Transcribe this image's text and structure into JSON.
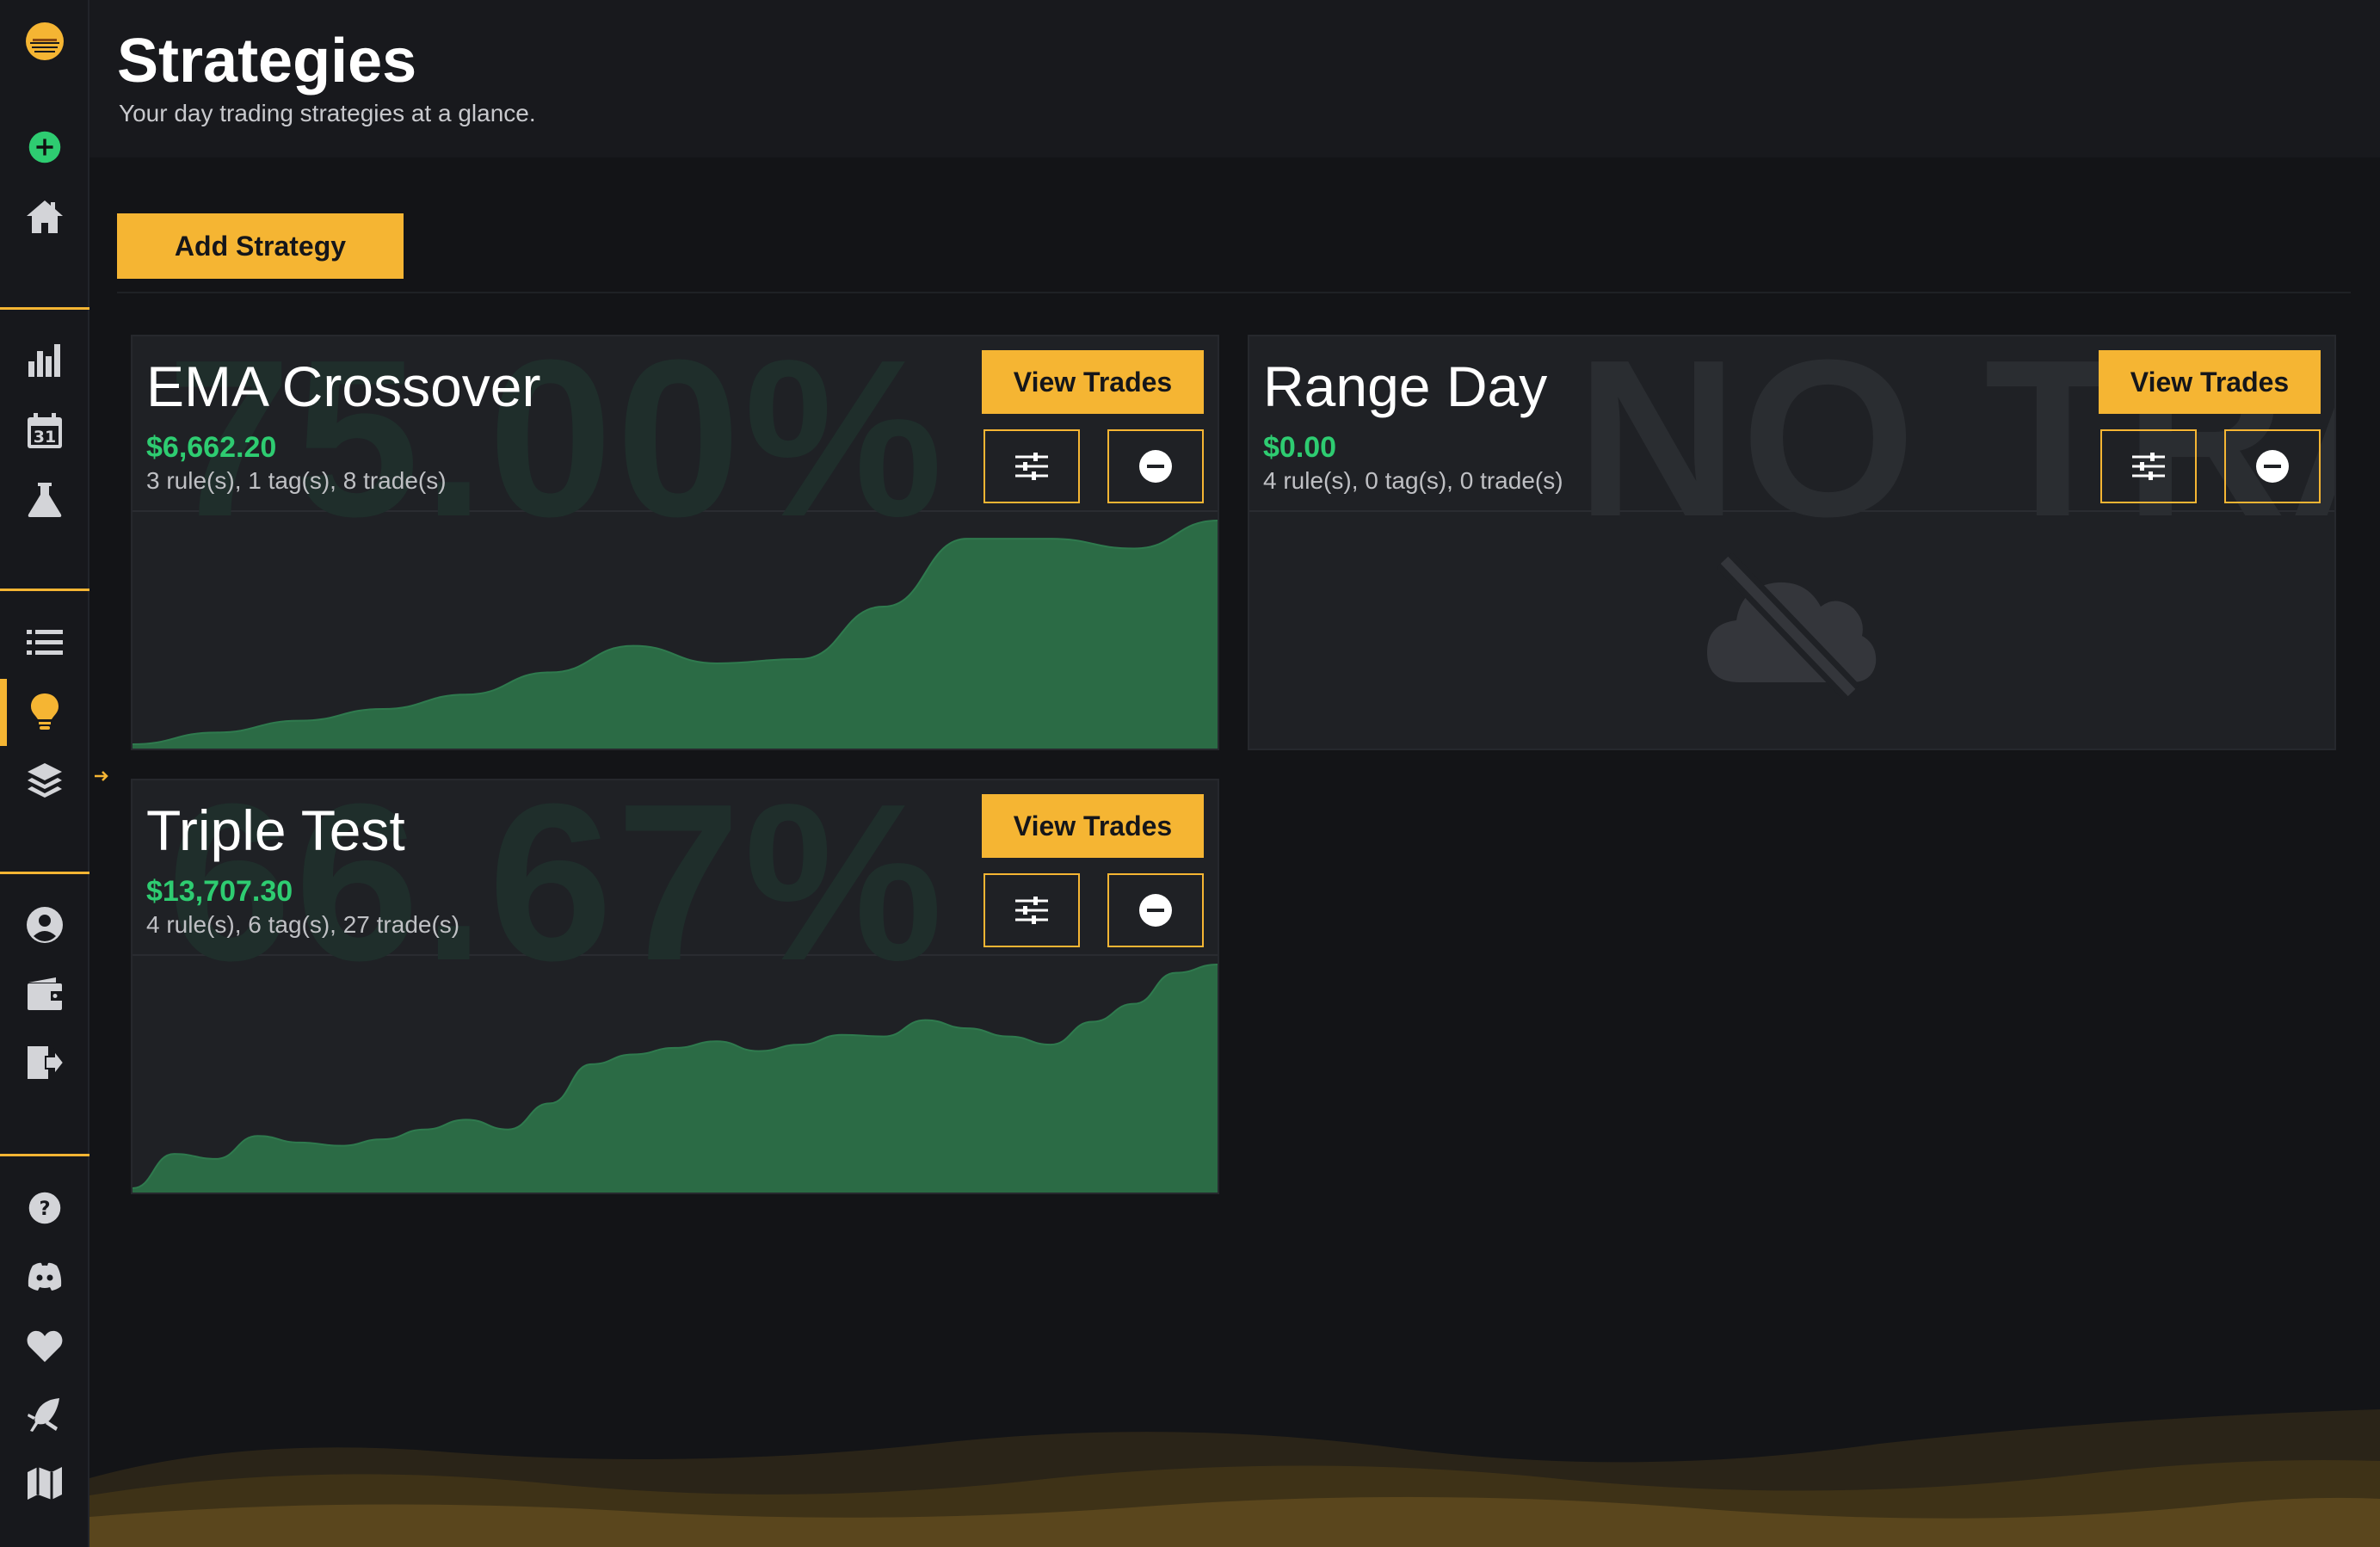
{
  "header": {
    "title": "Strategies",
    "subtitle": "Your day trading strategies at a glance."
  },
  "toolbar": {
    "add_label": "Add Strategy"
  },
  "colors": {
    "accent": "#f5b533",
    "positive": "#2ecc71",
    "chart_fill": "#2b6b45",
    "chart_stroke": "#2f7a4e"
  },
  "sidebar": {
    "icons": [
      "add-circle-icon",
      "home-icon",
      "bar-chart-icon",
      "calendar-icon",
      "flask-icon",
      "list-icon",
      "lightbulb-icon",
      "layers-icon",
      "user-icon",
      "wallet-icon",
      "logout-icon",
      "help-icon",
      "discord-icon",
      "heart-icon",
      "feather-icon",
      "map-icon"
    ],
    "calendar_day": "31",
    "active": "lightbulb-icon"
  },
  "strategies": [
    {
      "name": "EMA Crossover",
      "value": "$6,662.20",
      "meta": "3 rule(s), 1 tag(s), 8 trade(s)",
      "watermark": "75.00%",
      "view_label": "View Trades"
    },
    {
      "name": "Range Day",
      "value": "$0.00",
      "meta": "4 rule(s), 0 tag(s), 0 trade(s)",
      "watermark": "NO TRADES",
      "view_label": "View Trades"
    },
    {
      "name": "Triple Test",
      "value": "$13,707.30",
      "meta": "4 rule(s), 6 tag(s), 27 trade(s)",
      "watermark": "66.67%",
      "view_label": "View Trades"
    }
  ],
  "chart_data": [
    {
      "type": "area",
      "series": [
        {
          "values": [
            0,
            350,
            700,
            1050,
            1480,
            2140,
            2930,
            2410,
            2540,
            4100,
            6120,
            6120,
            5830,
            6662.2
          ]
        }
      ],
      "ylim": [
        0,
        6662.2
      ],
      "grid": false
    },
    {
      "type": "area",
      "series": [
        {
          "values": [
            0,
            2100,
            1800,
            3200,
            2800,
            2600,
            3000,
            3600,
            4200,
            3600,
            5200,
            7600,
            8200,
            8600,
            9000,
            8400,
            8800,
            9400,
            9300,
            10300,
            9800,
            9300,
            8800,
            10200,
            11300,
            13200,
            13707.3
          ]
        }
      ],
      "ylim": [
        0,
        13707.3
      ],
      "grid": false
    }
  ]
}
